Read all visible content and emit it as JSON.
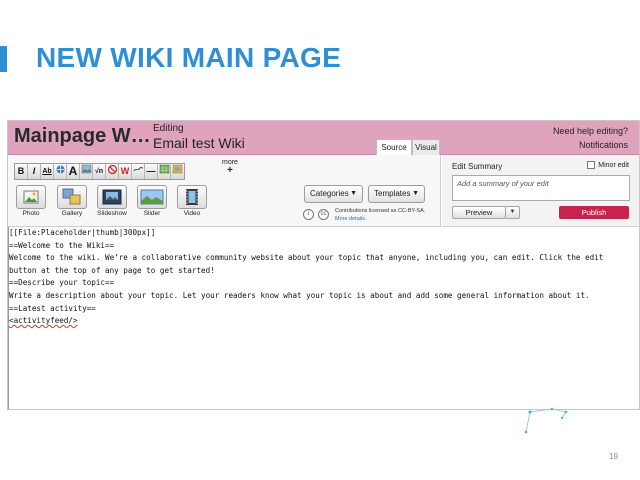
{
  "slide": {
    "title": "NEW WIKI MAIN PAGE",
    "page_number": "19",
    "accent_color": "#2e8fd6"
  },
  "header": {
    "page_name": "Mainpage W…",
    "editing_label": "Editing",
    "editing_title": "Email test Wiki",
    "help_link": "Need help editing?",
    "notifications_link": "Notifications",
    "bar_color": "#e0a3bd"
  },
  "tabs": [
    {
      "label": "Source",
      "active": true
    },
    {
      "label": "Visual",
      "active": false
    }
  ],
  "toolbar": {
    "format_buttons": [
      "B",
      "I",
      "Ab",
      "",
      "A",
      "",
      "√n",
      "",
      "W",
      "",
      "—",
      "",
      ""
    ],
    "format_icons": [
      "bold-icon",
      "italic-icon",
      "link-icon",
      "external-link-icon",
      "heading-icon",
      "picture-icon",
      "math-icon",
      "no-wiki-icon",
      "signature-icon",
      "strike-icon",
      "horizontal-rule-icon",
      "table-icon",
      "gallery-add-icon"
    ],
    "more_label": "more",
    "more_plus": "+",
    "media": [
      {
        "label": "Photo",
        "icon": "photo-icon"
      },
      {
        "label": "Gallery",
        "icon": "gallery-icon"
      },
      {
        "label": "Slideshow",
        "icon": "slideshow-icon"
      },
      {
        "label": "Slider",
        "icon": "slider-icon"
      },
      {
        "label": "Video",
        "icon": "video-icon"
      }
    ],
    "categories_label": "Categories",
    "templates_label": "Templates",
    "license_text": "Contributions licensed as CC-BY-SA.",
    "license_more": "More details."
  },
  "summary": {
    "label": "Edit Summary",
    "minor_edit_label": "Minor edit",
    "placeholder": "Add a summary of your edit",
    "preview_label": "Preview",
    "publish_label": "Publish",
    "publish_color": "#c8234f"
  },
  "editor": {
    "lines": [
      "[[File:Placeholder|thumb|300px]]",
      "==Welcome to the Wiki==",
      "",
      "Welcome to the wiki. We’re a collaborative community website about your topic that anyone, including you, can edit. Click the edit",
      "button at the top of any page to get started!",
      "",
      "==Describe your topic==",
      "",
      "Write a description about your topic. Let your readers know what your topic is about and add some general information about it.",
      "",
      "==Latest activity==",
      "",
      "<activityfeed/>"
    ]
  }
}
